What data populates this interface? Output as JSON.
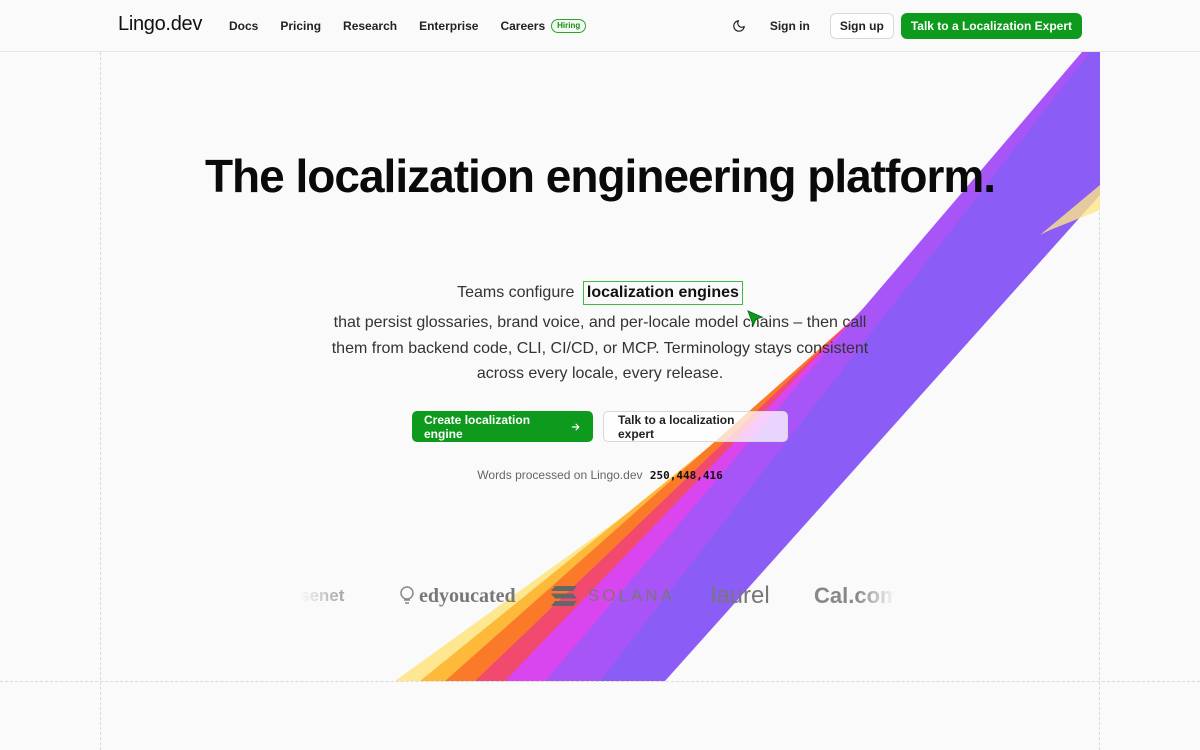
{
  "header": {
    "logo": "Lingo.dev",
    "nav": [
      {
        "label": "Docs"
      },
      {
        "label": "Pricing"
      },
      {
        "label": "Research"
      },
      {
        "label": "Enterprise"
      },
      {
        "label": "Careers",
        "badge": "Hiring"
      }
    ],
    "theme_icon": "moon-icon",
    "signin": "Sign in",
    "signup": "Sign up",
    "cta": "Talk to a Localization Expert"
  },
  "hero": {
    "title": "The localization engineering platform.",
    "subtitle_prefix": "Teams configure",
    "subtitle_highlight": "localization engines",
    "subtitle_rest": "that persist glossaries, brand voice, and per-locale model chains – then call them from backend code, CLI, CI/CD, or MCP. Terminology stays consistent across every locale, every release.",
    "primary_button": "Create localization engine",
    "secondary_button": "Talk to a localization expert",
    "words_label": "Words processed on Lingo.dev",
    "words_count": "250,448,416"
  },
  "logos": {
    "items": [
      "senet",
      "edyoucated",
      "SOLANA",
      "laurel",
      "Cal.com"
    ]
  },
  "colors": {
    "accent": "#0e9a1c",
    "ribbon": [
      "#fde68a",
      "#fdba3a",
      "#fb7a2a",
      "#f24a6e",
      "#d946ef",
      "#a855f7",
      "#8b5cf6"
    ]
  }
}
